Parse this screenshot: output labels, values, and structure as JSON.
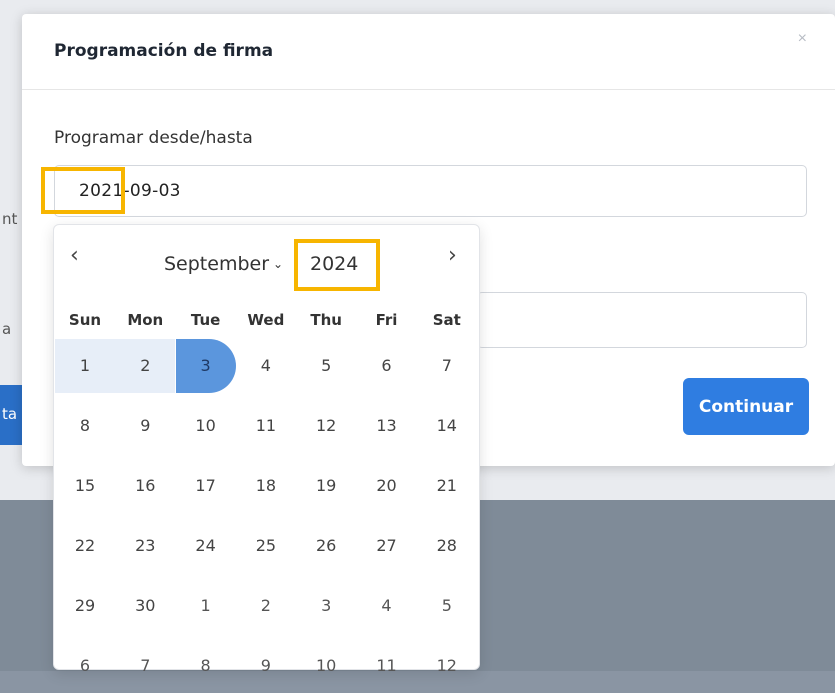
{
  "background": {
    "fragments": [
      "nt",
      "a",
      "ta"
    ]
  },
  "modal": {
    "title": "Programación de firma",
    "close_symbol": "×",
    "field_label": "Programar desde/hasta",
    "date_value": "2021-09-03",
    "continue_label": "Continuar"
  },
  "calendar": {
    "month_label": "September",
    "year_label": "2024",
    "prev_symbol": "‹",
    "next_symbol": "›",
    "chevron_symbol": "⌄",
    "weekdays": [
      "Sun",
      "Mon",
      "Tue",
      "Wed",
      "Thu",
      "Fri",
      "Sat"
    ],
    "weeks": [
      [
        "1",
        "2",
        "3",
        "4",
        "5",
        "6",
        "7"
      ],
      [
        "8",
        "9",
        "10",
        "11",
        "12",
        "13",
        "14"
      ],
      [
        "15",
        "16",
        "17",
        "18",
        "19",
        "20",
        "21"
      ],
      [
        "22",
        "23",
        "24",
        "25",
        "26",
        "27",
        "28"
      ],
      [
        "29",
        "30",
        "1",
        "2",
        "3",
        "4",
        "5"
      ],
      [
        "6",
        "7",
        "8",
        "9",
        "10",
        "11",
        "12"
      ]
    ],
    "selected_day": "3"
  },
  "colors": {
    "accent": "#2f7de1",
    "selected": "#5b96dd",
    "range": "#e7eef8",
    "highlight": "#f7b500"
  }
}
